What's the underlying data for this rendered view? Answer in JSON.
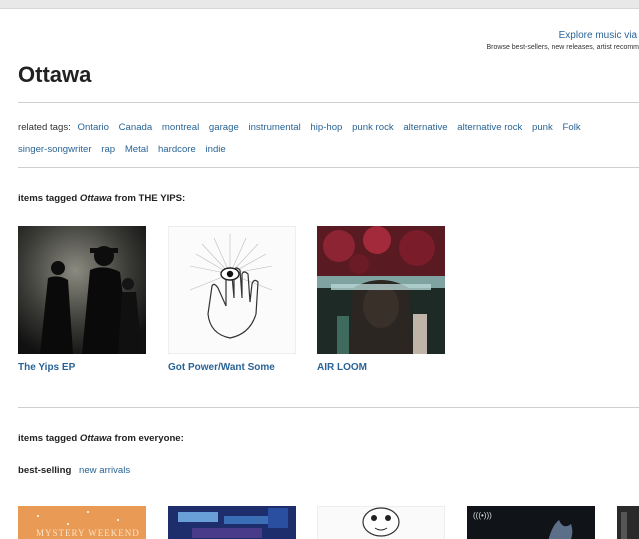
{
  "header": {
    "explore_text": "Explore music via",
    "browse_text": "Browse best-sellers, new releases, artist recomm"
  },
  "page": {
    "title": "Ottawa"
  },
  "related": {
    "label": "related tags:",
    "tags": [
      "Ontario",
      "Canada",
      "montreal",
      "garage",
      "instrumental",
      "hip-hop",
      "punk rock",
      "alternative",
      "alternative rock",
      "punk",
      "Folk",
      "singer-songwriter",
      "rap",
      "Metal",
      "hardcore",
      "indie"
    ]
  },
  "section_artist": {
    "prefix": "items tagged",
    "tag": "Ottawa",
    "suffix": "from THE YIPS:"
  },
  "artist_albums": [
    {
      "title": "The Yips EP"
    },
    {
      "title": "Got Power/Want Some"
    },
    {
      "title": "AIR LOOM"
    }
  ],
  "section_everyone": {
    "prefix": "items tagged",
    "tag": "Ottawa",
    "suffix": "from everyone:"
  },
  "sort_tabs": {
    "active": "best-selling",
    "other": "new arrivals"
  },
  "bottom_thumbs": [
    {
      "caption": "MYSTERY WEEKEND"
    },
    {
      "caption": ""
    },
    {
      "caption": ""
    },
    {
      "caption": ""
    },
    {
      "caption": ""
    }
  ],
  "colors": {
    "link": "#2a6496",
    "title": "#222222",
    "rule": "#cfcfcf"
  }
}
